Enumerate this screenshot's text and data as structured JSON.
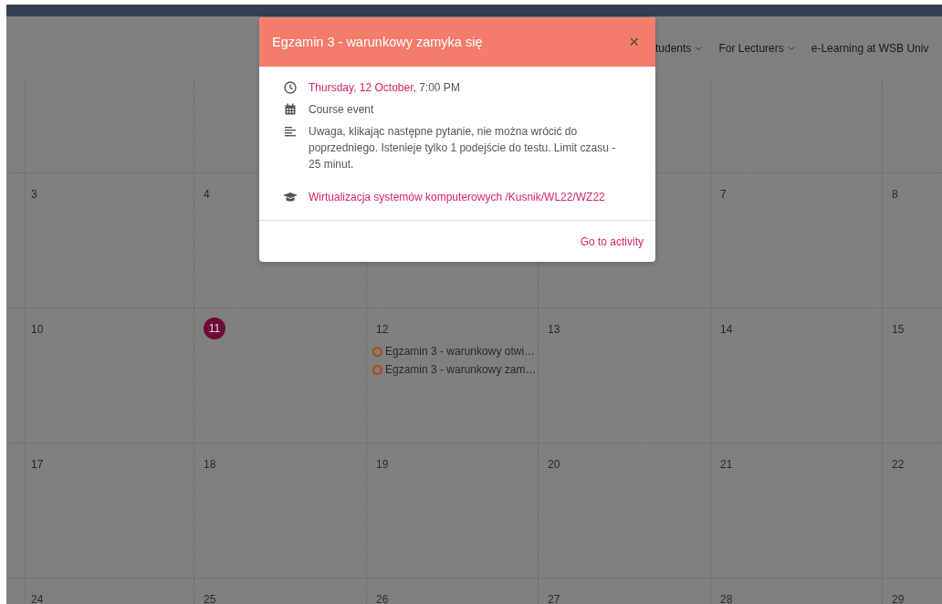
{
  "nav": [
    {
      "label": "tudents",
      "dropdown": true
    },
    {
      "label": "For Lecturers",
      "dropdown": true
    },
    {
      "label": "e-Learning at WSB Univ",
      "dropdown": false
    }
  ],
  "calendar": {
    "weeks": [
      {
        "days": [
          {
            "number": "3",
            "today": false
          },
          {
            "number": "4",
            "today": false
          },
          {
            "covered": true
          },
          {
            "covered": true
          },
          {
            "number": "7",
            "today": false
          },
          {
            "number": "8",
            "today": false
          }
        ]
      },
      {
        "days": [
          {
            "number": "10",
            "today": false
          },
          {
            "number": "11",
            "today": true
          },
          {
            "number": "12",
            "today": false,
            "events": [
              {
                "title": "Egzamin 3 - warunkowy otwi…",
                "color": "#b04a12"
              },
              {
                "title": "Egzamin 3 - warunkowy zam…",
                "color": "#b04a12"
              }
            ]
          },
          {
            "number": "13",
            "today": false
          },
          {
            "number": "14",
            "today": false
          },
          {
            "number": "15",
            "today": false
          }
        ]
      },
      {
        "days": [
          {
            "number": "17",
            "today": false
          },
          {
            "number": "18",
            "today": false
          },
          {
            "number": "19",
            "today": false
          },
          {
            "number": "20",
            "today": false
          },
          {
            "number": "21",
            "today": false
          },
          {
            "number": "22",
            "today": false
          }
        ]
      },
      {
        "days": [
          {
            "number": "24",
            "today": false
          },
          {
            "number": "25",
            "today": false
          },
          {
            "number": "26",
            "today": false
          },
          {
            "number": "27",
            "today": false
          },
          {
            "number": "28",
            "today": false
          },
          {
            "number": "29",
            "today": false
          }
        ]
      }
    ]
  },
  "popup": {
    "title": "Egzamin 3 - warunkowy zamyka się",
    "close": "×",
    "date_link": "Thursday, 12 October",
    "time": ", 7:00 PM",
    "event_type": "Course event",
    "description": "Uwaga, klikając następne pytanie, nie można wrócić do poprzedniego. Istenieje tylko 1 podejście do testu. Limit czasu - 25 minut.",
    "course": "Wirtualizacja systemów komputerowych /Kusnik/WL22/WZ22",
    "action": "Go to activity"
  }
}
